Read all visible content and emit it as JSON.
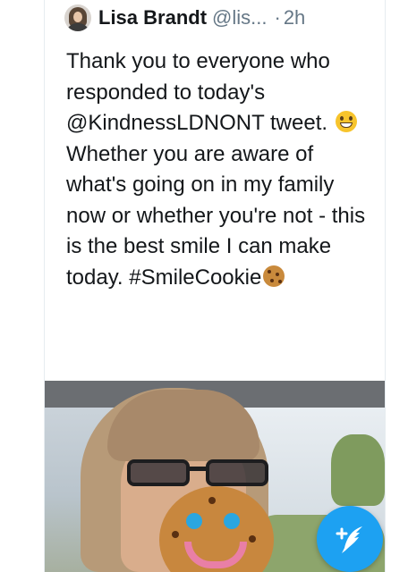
{
  "tweet": {
    "author_name": "Lisa Brandt",
    "handle": "@lis...",
    "separator": "·",
    "time": "2h",
    "text_part1": "Thank you to everyone who responded to today's @KindnessLDNONT tweet.",
    "text_part2": "Whether you are aware of what's going on in my family now or whether you're not - this is the best smile I can make today. #SmileCookie",
    "emoji_1": "grinning-face",
    "emoji_2": "cookie"
  },
  "compose_button": {
    "icon": "compose-tweet-icon",
    "color": "#1da1f2"
  },
  "colors": {
    "text": "#14171a",
    "secondary": "#657786",
    "accent": "#1da1f2"
  }
}
